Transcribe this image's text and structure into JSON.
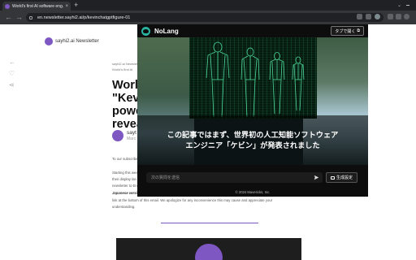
{
  "browser": {
    "tab": {
      "title": "World's first AI software eng..."
    },
    "new_tab_symbol": "+",
    "url": "en.newsletter.sayhi2.ai/p/kevinchatgptfigure-01"
  },
  "newsletter": {
    "brand": "sayhi2.ai Newsletter",
    "breadcrumb": "sayhi2.ai Newsletter",
    "breadcrumb2": "World's first AI",
    "title_lines": [
      "World",
      "\"Kevi",
      "powe",
      "revea"
    ],
    "author": "sayt",
    "date": "Marc",
    "body_lines": [
      "To our subscribe",
      "Starting this wee",
      "their display lan",
      "newsletter to En",
      "Japanese versi",
      "link at the bottom of this email. We apologize for any inconvenience this may cause and appreciate your",
      "understanding."
    ]
  },
  "popup": {
    "brand": "NoLang",
    "open_tab_label": "タブで開く",
    "subtitle_lines": [
      "この記事ではまず、世界初の人工知能ソフトウェア",
      "エンジニア「ケビン」が発表されました"
    ],
    "input_placeholder": "次の質問を送信",
    "generate_settings_label": "生成設定",
    "copyright": "© 2024 Mavericks, Inc."
  },
  "colors": {
    "accent_purple": "#7e57c2",
    "nolang_teal": "#2bb3a1",
    "matrix_green": "#32c878"
  },
  "icons": {
    "send": "paper-plane-icon",
    "open_tab": "external-link-icon",
    "settings": "video-settings-icon"
  }
}
